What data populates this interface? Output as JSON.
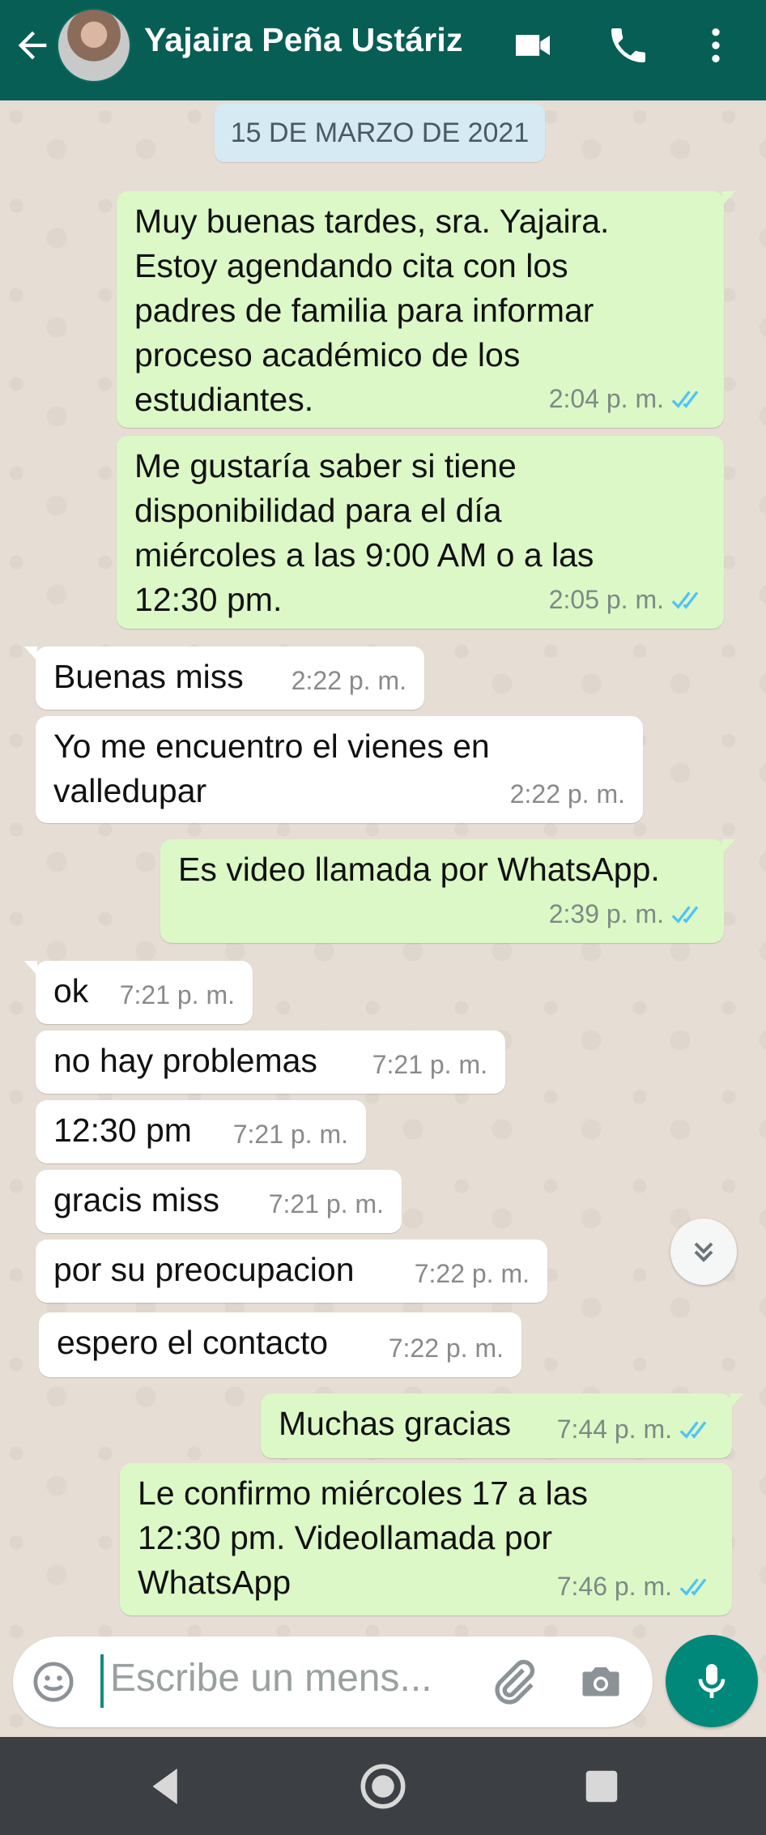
{
  "header": {
    "contact_name": "Yajaira Peña Ustáriz",
    "back_icon": "arrow-left-icon",
    "video_icon": "video-camera-icon",
    "call_icon": "phone-icon",
    "menu_icon": "more-vertical-icon"
  },
  "date_chip": "15 DE MARZO DE 2021",
  "messages": [
    {
      "direction": "out",
      "text": "Muy buenas tardes, sra. Yajaira.\nEstoy agendando cita con los\npadres de familia para informar\nproceso académico de los\nestudiantes.",
      "time": "2:04 p. m.",
      "read": true
    },
    {
      "direction": "out",
      "text": "Me gustaría saber si tiene\ndisponibilidad para el día\nmiércoles a las 9:00 AM o a las\n12:30 pm.",
      "time": "2:05 p. m.",
      "read": true
    },
    {
      "direction": "in",
      "text": "Buenas miss",
      "time": "2:22 p. m."
    },
    {
      "direction": "in",
      "text": "Yo me encuentro el vienes en\nvalledupar",
      "time": "2:22 p. m."
    },
    {
      "direction": "out",
      "text": "Es video llamada por WhatsApp.",
      "time": "2:39 p. m.",
      "read": true
    },
    {
      "direction": "in",
      "text": "ok",
      "time": "7:21 p. m."
    },
    {
      "direction": "in",
      "text": "no hay problemas",
      "time": "7:21 p. m."
    },
    {
      "direction": "in",
      "text": "12:30 pm",
      "time": "7:21 p. m."
    },
    {
      "direction": "in",
      "text": "gracis miss",
      "time": "7:21 p. m."
    },
    {
      "direction": "in",
      "text": "por su preocupacion",
      "time": "7:22 p. m."
    },
    {
      "direction": "in",
      "text": "espero el contacto",
      "time": "7:22 p. m."
    },
    {
      "direction": "out",
      "text": "Muchas gracias",
      "time": "7:44 p. m.",
      "read": true
    },
    {
      "direction": "out",
      "text": "Le confirmo miércoles 17 a las\n12:30 pm. Videollamada por\nWhatsApp",
      "time": "7:46 p. m.",
      "read": true
    }
  ],
  "composer": {
    "placeholder": "Escribe un mens...",
    "emoji_icon": "emoji-icon",
    "attach_icon": "paperclip-icon",
    "camera_icon": "camera-icon",
    "mic_icon": "microphone-icon"
  },
  "scroll_icon": "double-chevron-down-icon",
  "colors": {
    "header": "#075e54",
    "outgoing_bubble": "#dcf8c6",
    "incoming_bubble": "#ffffff",
    "read_ticks": "#4fc3f7",
    "mic_button": "#00897b"
  }
}
